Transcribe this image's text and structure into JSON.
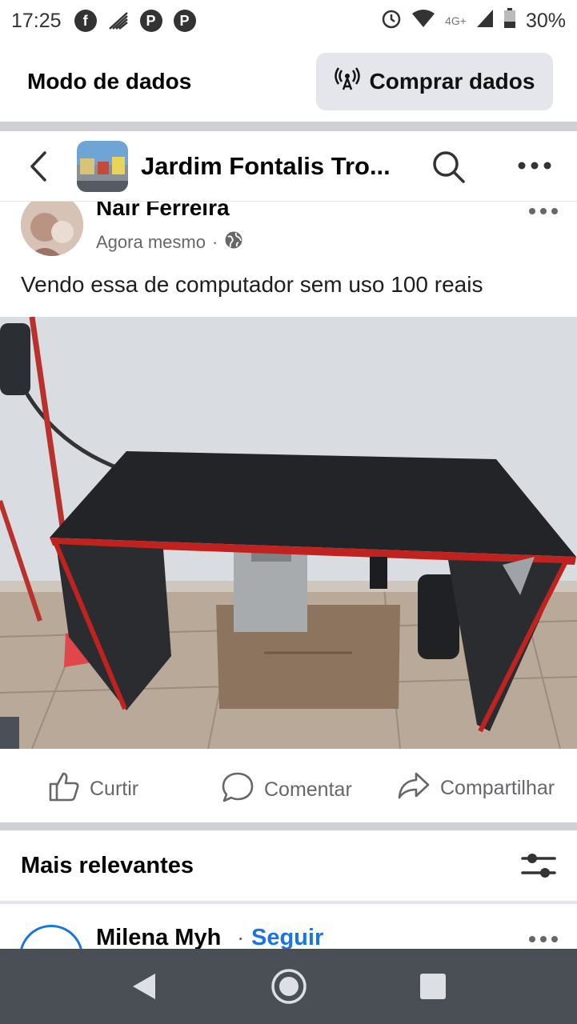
{
  "status_bar": {
    "time": "17:25",
    "network_label": "4G+",
    "battery": "30%",
    "icons": [
      "facebook-icon",
      "signal-waves-icon",
      "p-app-icon",
      "p-app-icon",
      "alarm-icon",
      "wifi-icon",
      "cell-signal-icon",
      "battery-icon"
    ],
    "p_letter": "P"
  },
  "data_bar": {
    "label": "Modo de dados",
    "buy_label": "Comprar dados"
  },
  "group": {
    "title": "Jardim Fontalis Tro..."
  },
  "post": {
    "author": "Nair Ferreira",
    "time": "Agora mesmo",
    "separator": "·",
    "text": "Vendo essa de computador sem uso  100 reais",
    "photo_subject": "mesa-computador-preta-vermelha"
  },
  "actions": {
    "like": "Curtir",
    "comment": "Comentar",
    "share": "Compartilhar"
  },
  "comments": {
    "sort_label": "Mais relevantes",
    "first": {
      "name": "Milena Myh",
      "separator": "·",
      "follow": "Seguir"
    }
  },
  "colors": {
    "accent": "#1b74e4",
    "secondary_text": "#65676b",
    "divider": "#ced0d4",
    "nav_bar": "#4a4f55"
  }
}
